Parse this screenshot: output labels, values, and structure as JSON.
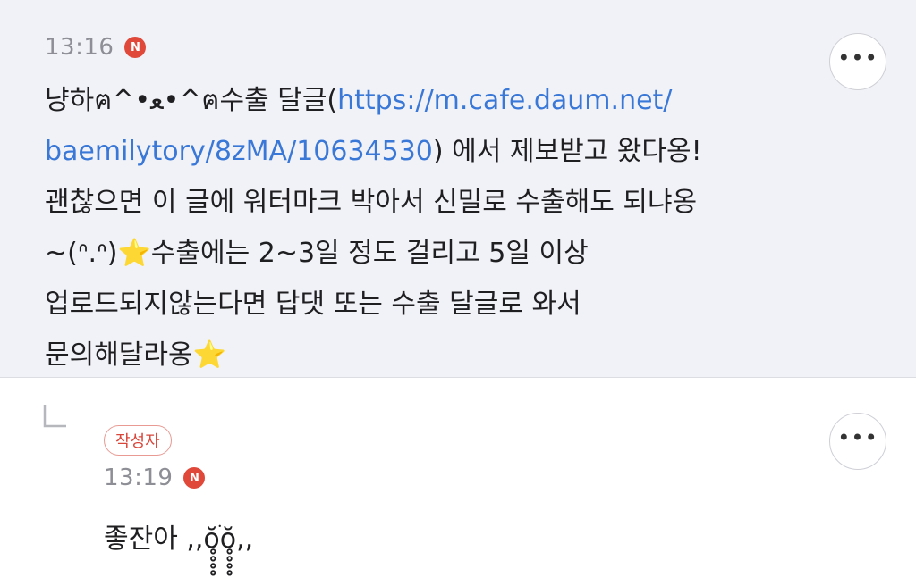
{
  "comments": [
    {
      "time": "13:16",
      "new_badge": "N",
      "more_label": "•••",
      "text_1": "냥하ฅ^•ﻌ•^ฅ수출 달글(",
      "link_1": "https://m.cafe.daum.net/",
      "link_2": "baemilytory/8zMA/10634530",
      "text_2": ") 에서 제보받고 왔다옹!\n괜찮으면 이 글에 워터마크 박아서 신밀로 수출해도 되냐옹\n~(ᐢ.ᐢ)",
      "star_1": "⭐",
      "text_3": "수출에는 2~3일 정도 걸리고 5일 이상\n업로드되지않는다면 답댓 또는 수출 달글로 와서\n문의해달라옹",
      "star_2": "⭐"
    },
    {
      "author_badge": "작성자",
      "time": "13:19",
      "new_badge": "N",
      "more_label": "•••",
      "text": "좋잔아 ,,ŏ̥̥̥̥ׄŏ̥̥̥̥,,"
    }
  ],
  "icons": {
    "reply": "reply-arrow-icon",
    "more": "more-horizontal-icon",
    "new": "new-badge-icon"
  },
  "colors": {
    "link": "#3a78d8",
    "new_badge": "#e0493a",
    "author_badge": "#d9473b",
    "highlight_bg": "#f1f2f7"
  }
}
